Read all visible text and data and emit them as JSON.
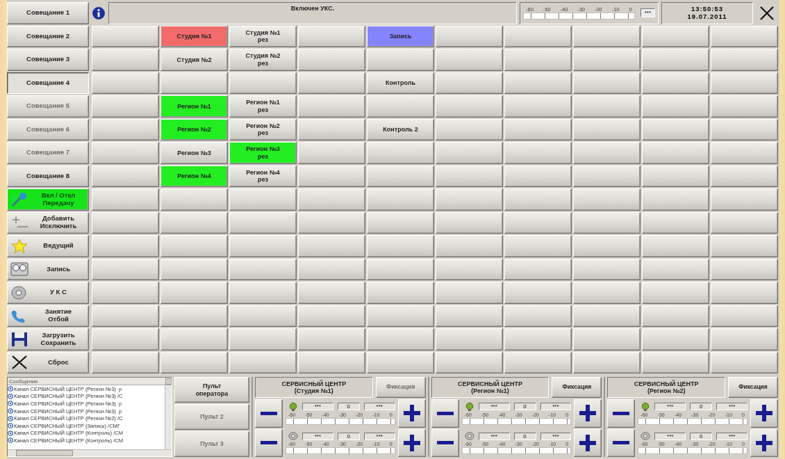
{
  "sidebar": {
    "meetings": [
      {
        "label": "Совещание 1",
        "selected": false,
        "disabled": false
      },
      {
        "label": "Совещание 2",
        "selected": false,
        "disabled": false
      },
      {
        "label": "Совещание 3",
        "selected": false,
        "disabled": false
      },
      {
        "label": "Совещание 4",
        "selected": true,
        "disabled": false
      },
      {
        "label": "Совещание 5",
        "selected": false,
        "disabled": true
      },
      {
        "label": "Совещание 6",
        "selected": false,
        "disabled": true
      },
      {
        "label": "Совещание 7",
        "selected": false,
        "disabled": true
      },
      {
        "label": "Совещание 8",
        "selected": false,
        "disabled": false
      }
    ],
    "tools": [
      {
        "label": "Вкл / Откл\nПередачу",
        "on": true
      },
      {
        "label": "Добавить\nИсключить",
        "on": false
      },
      {
        "label": "Ведущий",
        "on": false
      },
      {
        "label": "Запись",
        "on": false
      },
      {
        "label": "У К С",
        "on": false
      },
      {
        "label": "Занятие\nОтбой",
        "on": false
      },
      {
        "label": "Загрузить\nСохранить",
        "on": false
      },
      {
        "label": "Сброс",
        "on": false
      }
    ]
  },
  "top_bar": {
    "status": "Включен УКС.",
    "meter": {
      "scale": [
        "-60",
        "-50",
        "-40",
        "-30",
        "-20",
        "-10",
        "0"
      ],
      "value": "***"
    },
    "clock": {
      "time": "13:50:53",
      "date": "19.07.2011"
    }
  },
  "grid": [
    [
      {
        "kind": "empty"
      },
      {
        "kind": "channel",
        "label": "Студия №1",
        "color": "#f26a6a"
      },
      {
        "kind": "channel",
        "label": "Студия №1\nрез"
      },
      {
        "kind": "empty"
      },
      {
        "kind": "channel",
        "label": "Запись",
        "color": "#8484ff"
      },
      {
        "kind": "empty"
      },
      {
        "kind": "empty"
      },
      {
        "kind": "empty"
      },
      {
        "kind": "empty"
      },
      {
        "kind": "empty"
      }
    ],
    [
      {
        "kind": "empty"
      },
      {
        "kind": "channel",
        "label": "Студия №2"
      },
      {
        "kind": "channel",
        "label": "Студия №2\nрез"
      },
      {
        "kind": "empty"
      },
      {
        "kind": "empty"
      },
      {
        "kind": "empty"
      },
      {
        "kind": "empty"
      },
      {
        "kind": "empty"
      },
      {
        "kind": "empty"
      },
      {
        "kind": "empty"
      }
    ],
    [
      {
        "kind": "empty"
      },
      {
        "kind": "empty"
      },
      {
        "kind": "empty"
      },
      {
        "kind": "empty"
      },
      {
        "kind": "channel",
        "label": "Контроль"
      },
      {
        "kind": "empty"
      },
      {
        "kind": "empty"
      },
      {
        "kind": "empty"
      },
      {
        "kind": "empty"
      },
      {
        "kind": "empty"
      }
    ],
    [
      {
        "kind": "empty"
      },
      {
        "kind": "channel",
        "label": "Регион №1",
        "color": "#22ee22"
      },
      {
        "kind": "channel",
        "label": "Регион №1\nрез"
      },
      {
        "kind": "empty"
      },
      {
        "kind": "empty"
      },
      {
        "kind": "empty"
      },
      {
        "kind": "empty"
      },
      {
        "kind": "empty"
      },
      {
        "kind": "empty"
      },
      {
        "kind": "empty"
      }
    ],
    [
      {
        "kind": "empty"
      },
      {
        "kind": "channel",
        "label": "Регион №2",
        "color": "#22ee22"
      },
      {
        "kind": "channel",
        "label": "Регион №2\nрез"
      },
      {
        "kind": "empty"
      },
      {
        "kind": "channel",
        "label": "Контроль 2"
      },
      {
        "kind": "empty"
      },
      {
        "kind": "empty"
      },
      {
        "kind": "empty"
      },
      {
        "kind": "empty"
      },
      {
        "kind": "empty"
      }
    ],
    [
      {
        "kind": "empty"
      },
      {
        "kind": "channel",
        "label": "Регион №3"
      },
      {
        "kind": "channel",
        "label": "Регион №3\nрез",
        "color": "#22ee22"
      },
      {
        "kind": "empty"
      },
      {
        "kind": "empty"
      },
      {
        "kind": "empty"
      },
      {
        "kind": "empty"
      },
      {
        "kind": "empty"
      },
      {
        "kind": "empty"
      },
      {
        "kind": "empty"
      }
    ],
    [
      {
        "kind": "empty"
      },
      {
        "kind": "channel",
        "label": "Регион №4",
        "color": "#22ee22"
      },
      {
        "kind": "channel",
        "label": "Регион №4\nрез"
      },
      {
        "kind": "empty"
      },
      {
        "kind": "empty"
      },
      {
        "kind": "empty"
      },
      {
        "kind": "empty"
      },
      {
        "kind": "empty"
      },
      {
        "kind": "empty"
      },
      {
        "kind": "empty"
      }
    ],
    [
      {
        "kind": "empty"
      },
      {
        "kind": "empty"
      },
      {
        "kind": "empty"
      },
      {
        "kind": "empty"
      },
      {
        "kind": "empty"
      },
      {
        "kind": "empty"
      },
      {
        "kind": "empty"
      },
      {
        "kind": "empty"
      },
      {
        "kind": "empty"
      },
      {
        "kind": "empty"
      }
    ],
    [
      {
        "kind": "empty"
      },
      {
        "kind": "empty"
      },
      {
        "kind": "empty"
      },
      {
        "kind": "empty"
      },
      {
        "kind": "empty"
      },
      {
        "kind": "empty"
      },
      {
        "kind": "empty"
      },
      {
        "kind": "empty"
      },
      {
        "kind": "empty"
      },
      {
        "kind": "empty"
      }
    ],
    [
      {
        "kind": "empty"
      },
      {
        "kind": "empty"
      },
      {
        "kind": "empty"
      },
      {
        "kind": "empty"
      },
      {
        "kind": "empty"
      },
      {
        "kind": "empty"
      },
      {
        "kind": "empty"
      },
      {
        "kind": "empty"
      },
      {
        "kind": "empty"
      },
      {
        "kind": "empty"
      }
    ],
    [
      {
        "kind": "empty"
      },
      {
        "kind": "empty"
      },
      {
        "kind": "empty"
      },
      {
        "kind": "empty"
      },
      {
        "kind": "empty"
      },
      {
        "kind": "empty"
      },
      {
        "kind": "empty"
      },
      {
        "kind": "empty"
      },
      {
        "kind": "empty"
      },
      {
        "kind": "empty"
      }
    ],
    [
      {
        "kind": "empty"
      },
      {
        "kind": "empty"
      },
      {
        "kind": "empty"
      },
      {
        "kind": "empty"
      },
      {
        "kind": "empty"
      },
      {
        "kind": "empty"
      },
      {
        "kind": "empty"
      },
      {
        "kind": "empty"
      },
      {
        "kind": "empty"
      },
      {
        "kind": "empty"
      }
    ],
    [
      {
        "kind": "empty"
      },
      {
        "kind": "empty"
      },
      {
        "kind": "empty"
      },
      {
        "kind": "empty"
      },
      {
        "kind": "empty"
      },
      {
        "kind": "empty"
      },
      {
        "kind": "empty"
      },
      {
        "kind": "empty"
      },
      {
        "kind": "empty"
      },
      {
        "kind": "empty"
      }
    ],
    [
      {
        "kind": "empty"
      },
      {
        "kind": "empty"
      },
      {
        "kind": "empty"
      },
      {
        "kind": "empty"
      },
      {
        "kind": "empty"
      },
      {
        "kind": "empty"
      },
      {
        "kind": "empty"
      },
      {
        "kind": "empty"
      },
      {
        "kind": "empty"
      },
      {
        "kind": "empty"
      }
    ],
    [
      {
        "kind": "empty"
      },
      {
        "kind": "empty"
      },
      {
        "kind": "empty"
      },
      {
        "kind": "empty"
      },
      {
        "kind": "empty"
      },
      {
        "kind": "empty"
      },
      {
        "kind": "empty"
      },
      {
        "kind": "empty"
      },
      {
        "kind": "empty"
      },
      {
        "kind": "empty"
      }
    ]
  ],
  "messages": {
    "title": "Сообщения",
    "items": [
      "Канал СЕРВИСНЫЙ ЦЕНТР (Регион №3)  р",
      "Канал СЕРВИСНЫЙ ЦЕНТР (Регион №3) /С",
      "Канал СЕРВИСНЫЙ ЦЕНТР (Регион №3)  р",
      "Канал СЕРВИСНЫЙ ЦЕНТР (Регион №3)  р",
      "Канал СЕРВИСНЫЙ ЦЕНТР (Регион №2) /С",
      "Канал СЕРВИСНЫЙ ЦЕНТР (Запись) /СМГ",
      "Канал СЕРВИСНЫЙ ЦЕНТР (Контроль) /СМ",
      "Канал СЕРВИСНЫЙ ЦЕНТР (Контроль) /СМ"
    ]
  },
  "consoles": [
    {
      "label": "Пульт\nоператора",
      "disabled": false
    },
    {
      "label": "Пульт 2",
      "disabled": true
    },
    {
      "label": "Пульт 3",
      "disabled": true
    }
  ],
  "channels": [
    {
      "title": "СЕРВИСНЫЙ ЦЕНТР",
      "subtitle": "(Студия №1)",
      "fix": {
        "label": "Фиксация",
        "disabled": true
      },
      "rows": [
        {
          "kind": "mic",
          "left": "***",
          "center": "0",
          "right": "***",
          "scale": [
            "-60",
            "-50",
            "-40",
            "-30",
            "-20",
            "-10",
            "0"
          ]
        },
        {
          "kind": "speaker",
          "left": "***",
          "center": "0",
          "right": "***",
          "scale": [
            "-60",
            "-50",
            "-40",
            "-30",
            "-20",
            "-10",
            "0"
          ]
        }
      ]
    },
    {
      "title": "СЕРВИСНЫЙ ЦЕНТР",
      "subtitle": "(Регион №1)",
      "fix": {
        "label": "Фиксация",
        "disabled": false
      },
      "rows": [
        {
          "kind": "mic",
          "left": "***",
          "center": "0",
          "right": "***",
          "scale": [
            "-60",
            "-50",
            "-40",
            "-30",
            "-20",
            "-10",
            "0"
          ]
        },
        {
          "kind": "speaker",
          "left": "***",
          "center": "0",
          "right": "***",
          "scale": [
            "-60",
            "-50",
            "-40",
            "-30",
            "-20",
            "-10",
            "0"
          ]
        }
      ]
    },
    {
      "title": "СЕРВИСНЫЙ ЦЕНТР",
      "subtitle": "(Регион №2)",
      "fix": {
        "label": "Фиксация",
        "disabled": false
      },
      "rows": [
        {
          "kind": "mic",
          "left": "***",
          "center": "0",
          "right": "***",
          "scale": [
            "-60",
            "-50",
            "-40",
            "-30",
            "-20",
            "-10",
            "0"
          ]
        },
        {
          "kind": "speaker",
          "left": "***",
          "center": "0",
          "right": "***",
          "scale": [
            "-60",
            "-50",
            "-40",
            "-30",
            "-20",
            "-10",
            "0"
          ]
        }
      ]
    }
  ]
}
